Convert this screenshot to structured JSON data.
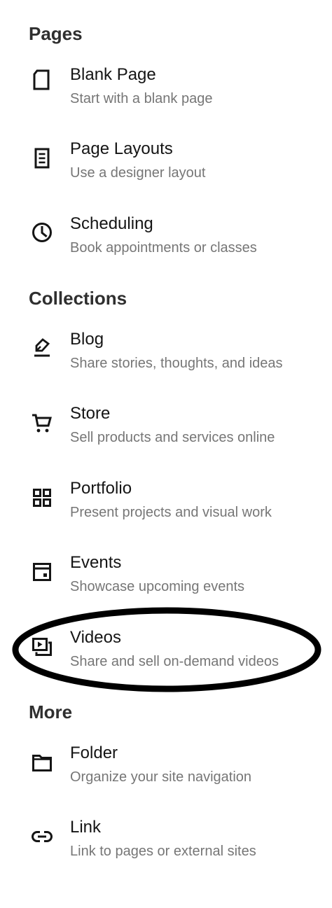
{
  "sections": [
    {
      "title": "Pages",
      "items": [
        {
          "title": "Blank Page",
          "desc": "Start with a blank page",
          "icon": "blank-page-icon"
        },
        {
          "title": "Page Layouts",
          "desc": "Use a designer layout",
          "icon": "page-layouts-icon"
        },
        {
          "title": "Scheduling",
          "desc": "Book appointments or classes",
          "icon": "clock-icon"
        }
      ]
    },
    {
      "title": "Collections",
      "items": [
        {
          "title": "Blog",
          "desc": "Share stories, thoughts, and ideas",
          "icon": "pen-icon"
        },
        {
          "title": "Store",
          "desc": "Sell products and services online",
          "icon": "cart-icon"
        },
        {
          "title": "Portfolio",
          "desc": "Present projects and visual work",
          "icon": "grid-icon"
        },
        {
          "title": "Events",
          "desc": "Showcase upcoming events",
          "icon": "calendar-icon"
        },
        {
          "title": "Videos",
          "desc": "Share and sell on-demand videos",
          "icon": "video-icon"
        }
      ]
    },
    {
      "title": "More",
      "items": [
        {
          "title": "Folder",
          "desc": "Organize your site navigation",
          "icon": "folder-icon"
        },
        {
          "title": "Link",
          "desc": "Link to pages or external sites",
          "icon": "link-icon"
        }
      ]
    }
  ],
  "colors": {
    "title": "#151515",
    "description": "#767676",
    "section_heading": "#2f2f2f",
    "highlight_ring": "#000000"
  }
}
